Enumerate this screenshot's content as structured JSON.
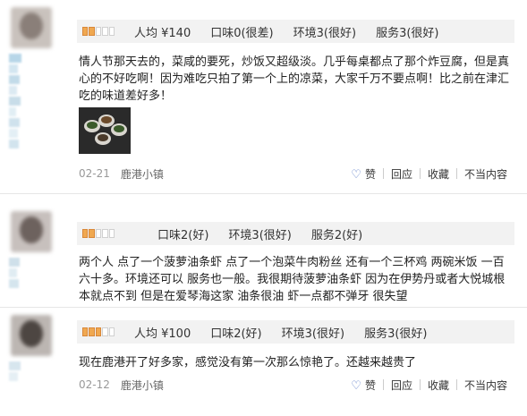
{
  "reviews": [
    {
      "ratings": {
        "avg": "人均 ¥140",
        "taste": "口味0(很差)",
        "env": "环境3(很好)",
        "service": "服务3(很好)"
      },
      "text": "情人节那天去的，菜咸的要死，炒饭又超级淡。几乎每桌都点了那个炸豆腐，但是真心的不好吃啊！因为难吃只拍了第一个上的凉菜，大家千万不要点啊！比之前在津汇吃的味道差好多！",
      "date": "02-21",
      "shop": "鹿港小镇",
      "actions": {
        "like": "赞",
        "reply": "回应",
        "fav": "收藏",
        "report": "不当内容"
      }
    },
    {
      "ratings": {
        "taste": "口味2(好)",
        "env": "环境3(很好)",
        "service": "服务2(好)"
      },
      "text": "两个人 点了一个菠萝油条虾 点了一个泡菜牛肉粉丝 还有一个三杯鸡 两碗米饭 一百六十多。环境还可以 服务也一般。我很期待菠萝油条虾 因为在伊势丹或者大悦城根本就点不到 但是在爱琴海这家 油条很油 虾一点都不弹牙 很失望"
    },
    {
      "ratings": {
        "avg": "人均 ¥100",
        "taste": "口味2(好)",
        "env": "环境3(很好)",
        "service": "服务3(很好)"
      },
      "text": "现在鹿港开了好多家，感觉没有第一次那么惊艳了。还越来越贵了",
      "date": "02-12",
      "shop": "鹿港小镇",
      "actions": {
        "like": "赞",
        "reply": "回应",
        "fav": "收藏",
        "report": "不当内容"
      }
    }
  ],
  "colors": {
    "star": "#f0a850",
    "accent": "#5a7bc8",
    "bar_bg": "#f2f2f2"
  }
}
